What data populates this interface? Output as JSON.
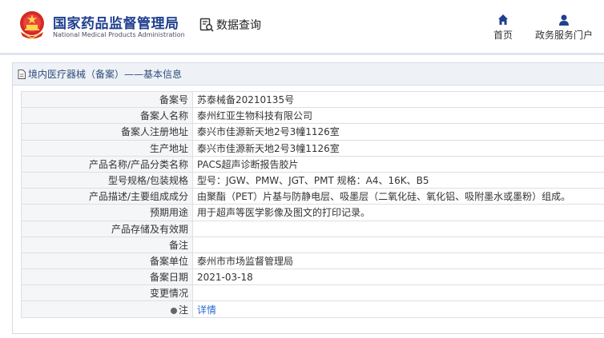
{
  "header": {
    "brand_cn": "国家药品监督管理局",
    "brand_en": "National Medical Products Administration",
    "data_query": "数据查询",
    "nav": [
      {
        "label": "首页",
        "icon": "home-icon"
      },
      {
        "label": "政务服务门户",
        "icon": "user-icon"
      }
    ]
  },
  "panel": {
    "title": "境内医疗器械（备案）——基本信息"
  },
  "rows": [
    {
      "label": "备案号",
      "value": "苏泰械备20210135号"
    },
    {
      "label": "备案人名称",
      "value": "泰州红亚生物科技有限公司"
    },
    {
      "label": "备案人注册地址",
      "value": "泰兴市佳源新天地2号3幢1126室"
    },
    {
      "label": "生产地址",
      "value": "泰兴市佳源新天地2号3幢1126室"
    },
    {
      "label": "产品名称/产品分类名称",
      "value": "PACS超声诊断报告胶片"
    },
    {
      "label": "型号规格/包装规格",
      "value": "型号：JGW、PMW、JGT、PMT 规格：A4、16K、B5"
    },
    {
      "label": "产品描述/主要组成成分",
      "value": "由聚酯（PET）片基与防静电层、吸墨层（二氧化硅、氧化铝、吸附墨水或墨粉）组成。"
    },
    {
      "label": "预期用途",
      "value": "用于超声等医学影像及图文的打印记录。"
    },
    {
      "label": "产品存储及有效期",
      "value": ""
    },
    {
      "label": "备注",
      "value": ""
    },
    {
      "label": "备案单位",
      "value": "泰州市市场监督管理局"
    },
    {
      "label": "备案日期",
      "value": "2021-03-18"
    },
    {
      "label": "变更情况",
      "value": ""
    }
  ],
  "note_row": {
    "label": "注",
    "link": "详情"
  },
  "colors": {
    "brand": "#1f3f8e",
    "accent": "#c4161c",
    "link": "#2a6bd1",
    "panel_head": "#eef2f7"
  }
}
